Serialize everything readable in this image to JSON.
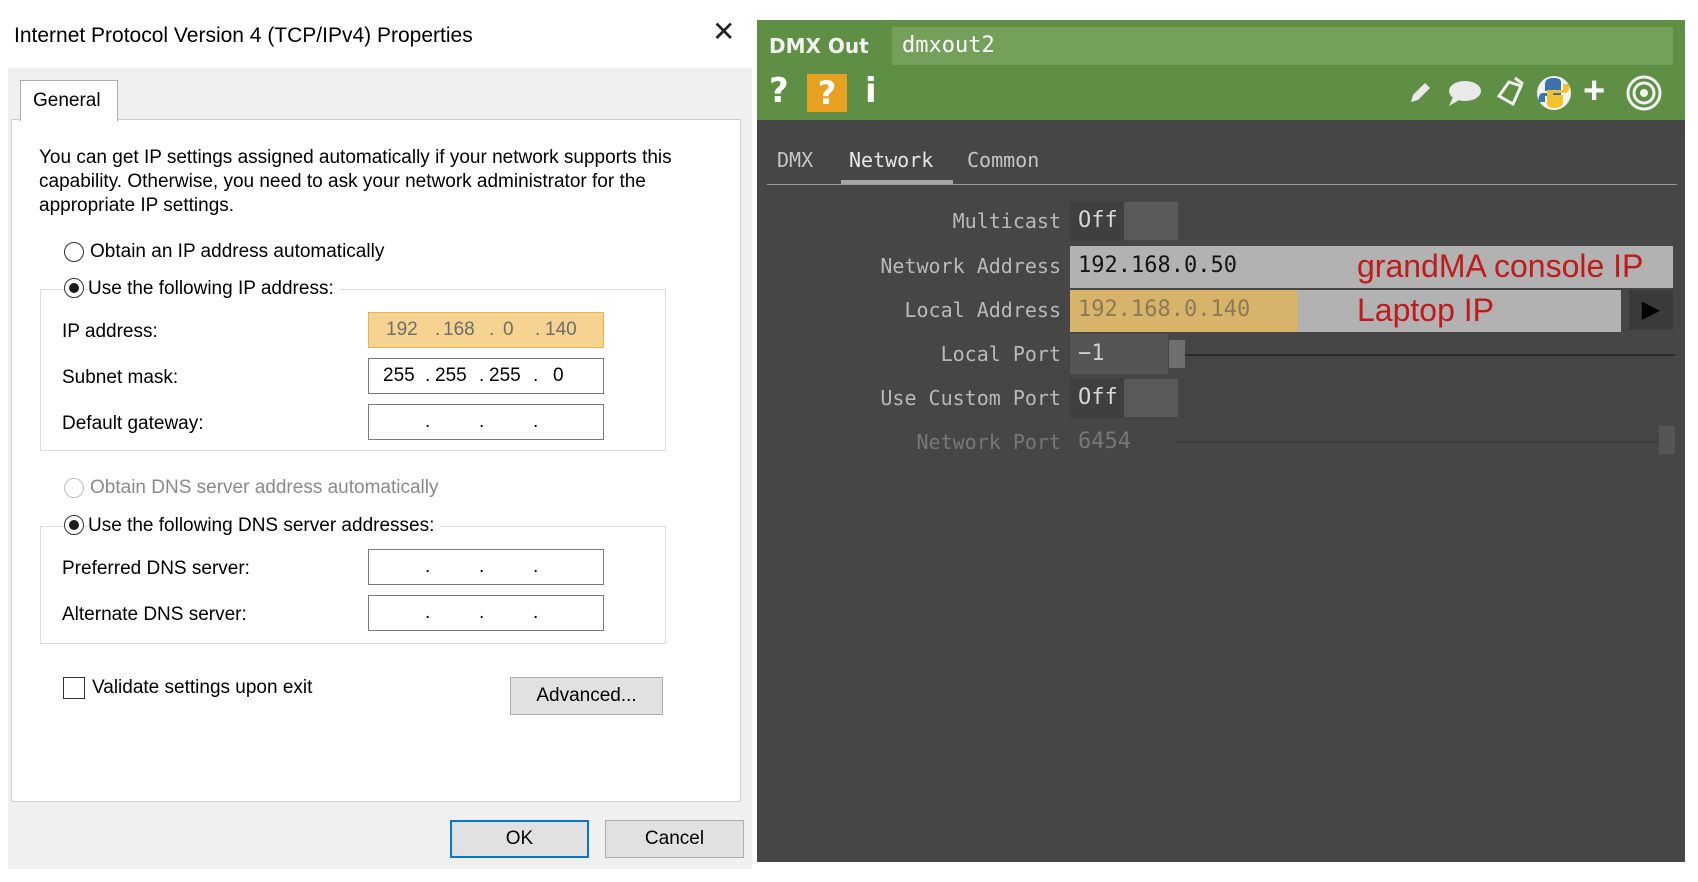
{
  "dialog": {
    "title": "Internet Protocol Version 4 (TCP/IPv4) Properties",
    "close_glyph": "✕",
    "tab": "General",
    "info": "You can get IP settings assigned automatically if your network supports this capability. Otherwise, you need to ask your network administrator for the appropriate IP settings.",
    "ip_auto_label": "Obtain an IP address automatically",
    "ip_manual_label": "Use the following IP address:",
    "ip_address_label": "IP address:",
    "ip_address": [
      "192",
      "168",
      "0",
      "140"
    ],
    "subnet_label": "Subnet mask:",
    "subnet": [
      "255",
      "255",
      "255",
      "0"
    ],
    "gateway_label": "Default gateway:",
    "dns_auto_label": "Obtain DNS server address automatically",
    "dns_manual_label": "Use the following DNS server addresses:",
    "preferred_dns_label": "Preferred DNS server:",
    "alternate_dns_label": "Alternate DNS server:",
    "dot": ".",
    "validate_label": "Validate settings upon exit",
    "advanced_button": "Advanced...",
    "ok_button": "OK",
    "cancel_button": "Cancel",
    "highlight_color": "#f6d390"
  },
  "td": {
    "op_type": "DMX Out",
    "op_name": "dmxout2",
    "header_color": "#5f8e45",
    "icons": {
      "help": "?",
      "python_help": "?",
      "info": "i",
      "right": [
        "pencil-icon",
        "comment-icon",
        "clone-icon",
        "python-icon",
        "plus-icon",
        "viewer-icon"
      ]
    },
    "tabs": [
      "DMX",
      "Network",
      "Common"
    ],
    "active_tab": "Network",
    "params": {
      "multicast_label": "Multicast",
      "multicast_value": "Off",
      "network_address_label": "Network Address",
      "network_address_value": "192.168.0.50",
      "local_address_label": "Local Address",
      "local_address_value": "192.168.0.140",
      "local_port_label": "Local Port",
      "local_port_value": "−1",
      "use_custom_port_label": "Use Custom Port",
      "use_custom_port_value": "Off",
      "network_port_label": "Network Port",
      "network_port_value": "6454"
    },
    "annotations": {
      "network_address": "grandMA console IP",
      "local_address": "Laptop IP",
      "color": "#c01a1a"
    },
    "menu_arrow": "▶"
  }
}
